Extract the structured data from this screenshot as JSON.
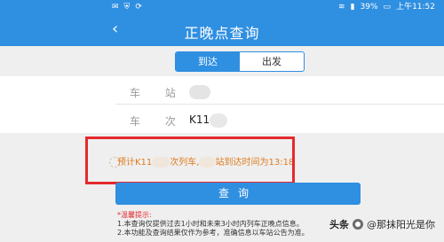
{
  "colors": {
    "accent": "#2f8fe1",
    "alert_border": "#e5292c",
    "result_text": "#e07b1e",
    "tips_title": "#e5292c",
    "background": "#efefef"
  },
  "status_bar": {
    "left_icons": [
      "message-icon",
      "shield-icon",
      "sync-icon"
    ],
    "right_icons": [
      "wifi-icon",
      "signal-icon",
      "battery-icon"
    ],
    "battery": "39%",
    "time": "上午11:52"
  },
  "header": {
    "back_icon": "chevron-left-icon",
    "title": "正晚点查询"
  },
  "tabs": [
    {
      "label": "到达",
      "active": true
    },
    {
      "label": "出发",
      "active": false
    }
  ],
  "form": {
    "station_label": "车 站",
    "train_label": "车 次",
    "train_value": "K11"
  },
  "result": {
    "prefix": "预计K11",
    "middle": "次列车,",
    "suffix": "站到达时间为13:18"
  },
  "query_button": "查询",
  "tips": {
    "title": "*温馨提示:",
    "line1": "1.本查询仅提供过去1小时和未来3小时内列车正晚点信息。",
    "line2": "2.本功能及查询结果仅作为参考，准确信息以车站公告为准。"
  },
  "watermark": {
    "platform": "头条",
    "handle": "@那抹阳光是你"
  }
}
